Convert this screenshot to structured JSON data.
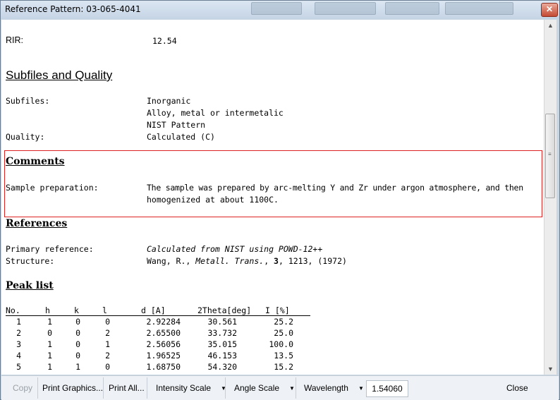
{
  "window": {
    "title": "Reference Pattern: 03-065-4041",
    "close_glyph": "✕"
  },
  "rir": {
    "label": "RIR:",
    "value": "12.54"
  },
  "subfiles_section": {
    "heading": "Subfiles and Quality",
    "subfiles_label": "Subfiles:",
    "subfiles": [
      "Inorganic",
      "Alloy, metal or intermetalic",
      "NIST Pattern"
    ],
    "quality_label": "Quality:",
    "quality_value": "Calculated (C)"
  },
  "comments_section": {
    "heading": "Comments",
    "sample_prep_label": "Sample preparation:",
    "sample_prep_line1": "The sample was prepared by arc-melting Y and Zr under argon atmosphere, and then",
    "sample_prep_line2": "homogenized at about 1100C."
  },
  "references_section": {
    "heading": "References",
    "primary_label": "Primary reference:",
    "primary_value": "Calculated from NIST using POWD-12++",
    "structure_label": "Structure:",
    "structure_author": "Wang, R., ",
    "structure_journal": "Metall. Trans.",
    "structure_sep": ", ",
    "structure_volume": "3",
    "structure_rest": ", 1213, (1972)"
  },
  "peak_list": {
    "heading": "Peak list",
    "columns": [
      "No.",
      "h",
      "k",
      "l",
      "d [A]",
      "2Theta[deg]",
      "I [%]"
    ],
    "rows": [
      [
        "1",
        "1",
        "0",
        "0",
        "2.92284",
        "30.561",
        "25.2"
      ],
      [
        "2",
        "0",
        "0",
        "2",
        "2.65500",
        "33.732",
        "25.0"
      ],
      [
        "3",
        "1",
        "0",
        "1",
        "2.56056",
        "35.015",
        "100.0"
      ],
      [
        "4",
        "1",
        "0",
        "2",
        "1.96525",
        "46.153",
        "13.5"
      ],
      [
        "5",
        "1",
        "1",
        "0",
        "1.68750",
        "54.320",
        "15.2"
      ]
    ]
  },
  "toolbar": {
    "copy": "Copy",
    "print_graphics": "Print Graphics...",
    "print_all": "Print All...",
    "intensity_scale": "Intensity Scale",
    "angle_scale": "Angle Scale",
    "wavelength": "Wavelength",
    "wavelength_value": "1.54060",
    "close": "Close",
    "dropdown_glyph": "▼"
  },
  "scrollbar": {
    "up_glyph": "▲",
    "down_glyph": "▼",
    "grip_glyph": "≡"
  },
  "colors": {
    "highlight_border": "#dd2222",
    "titlebar": "#c5d4e5"
  }
}
